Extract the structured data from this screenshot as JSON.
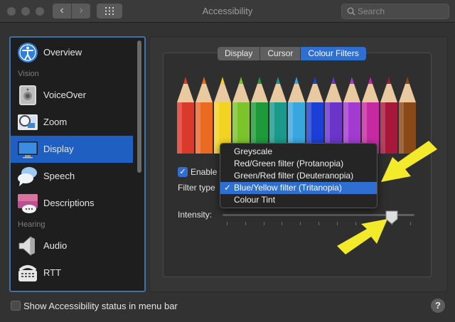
{
  "window": {
    "title": "Accessibility"
  },
  "toolbar": {
    "back": "‹",
    "forward": "›"
  },
  "search": {
    "placeholder": "Search"
  },
  "sidebar": {
    "items": [
      {
        "label": "Overview",
        "icon": "accessibility-person-icon"
      },
      {
        "header": "Vision"
      },
      {
        "label": "VoiceOver",
        "icon": "voiceover-icon"
      },
      {
        "label": "Zoom",
        "icon": "zoom-icon"
      },
      {
        "label": "Display",
        "icon": "display-icon",
        "selected": true
      },
      {
        "label": "Speech",
        "icon": "speech-bubble-icon"
      },
      {
        "label": "Descriptions",
        "icon": "descriptions-icon"
      },
      {
        "header": "Hearing"
      },
      {
        "label": "Audio",
        "icon": "speaker-icon"
      },
      {
        "label": "RTT",
        "icon": "tty-phone-icon"
      }
    ]
  },
  "tabs": [
    {
      "label": "Display",
      "active": false
    },
    {
      "label": "Cursor",
      "active": false
    },
    {
      "label": "Colour Filters",
      "active": true
    }
  ],
  "colour_filters": {
    "enable_label": "Enable",
    "enable_checked": true,
    "filter_type_label": "Filter type",
    "intensity_label": "Intensity:",
    "intensity_value": 0.88
  },
  "dropdown": {
    "options": [
      {
        "label": "Greyscale",
        "selected": false
      },
      {
        "label": "Red/Green filter (Protanopia)",
        "selected": false
      },
      {
        "label": "Green/Red filter (Deuteranopia)",
        "selected": false
      },
      {
        "label": "Blue/Yellow filter (Tritanopia)",
        "selected": true
      },
      {
        "label": "Colour Tint",
        "selected": false
      }
    ],
    "check_glyph": "✓"
  },
  "footer": {
    "show_status_label": "Show Accessibility status in menu bar",
    "show_status_checked": false,
    "help": "?"
  },
  "colors": {
    "accent": "#2e6fd1",
    "annotation_arrow": "#f2ea2b",
    "pencils": [
      "#d93a2b",
      "#ea6a22",
      "#f2d321",
      "#7bc42a",
      "#1f9a3a",
      "#199a8a",
      "#3aa6e0",
      "#1c3fd4",
      "#6b35c9",
      "#a33ad1",
      "#c62aa3",
      "#a8173a",
      "#8a4a17"
    ]
  }
}
